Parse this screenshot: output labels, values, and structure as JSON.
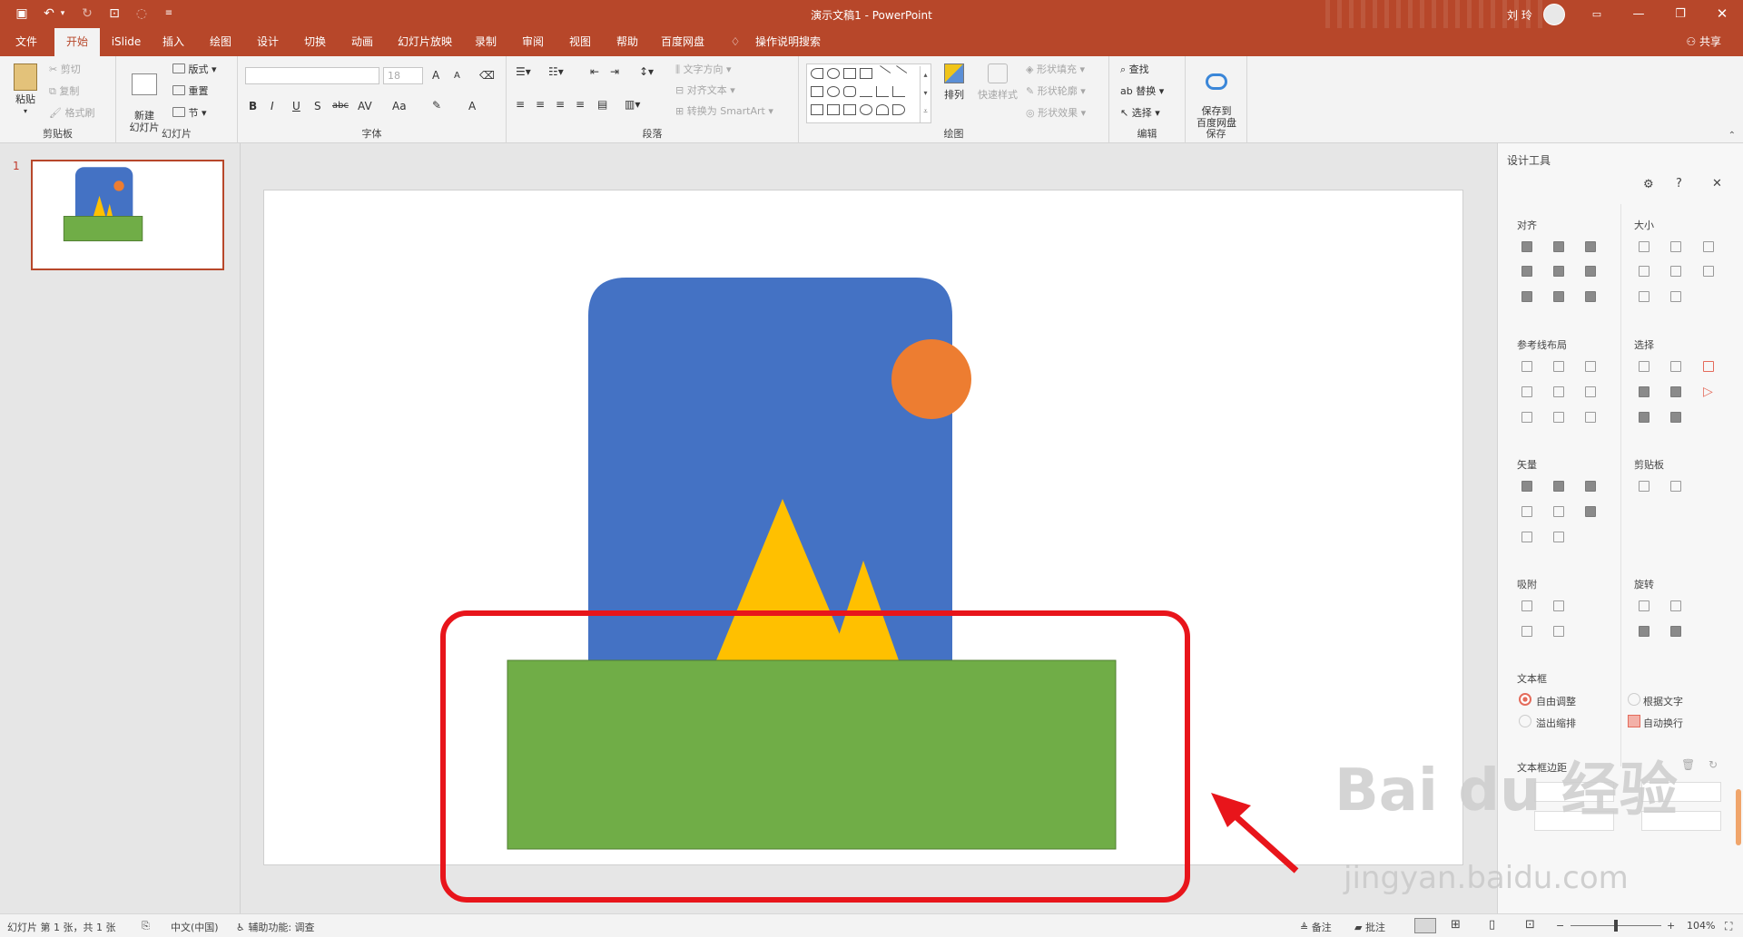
{
  "titlebar": {
    "title": "演示文稿1  -  PowerPoint",
    "user": "刘 玲"
  },
  "tabs": [
    "文件",
    "开始",
    "iSlide",
    "插入",
    "绘图",
    "设计",
    "切换",
    "动画",
    "幻灯片放映",
    "录制",
    "审阅",
    "视图",
    "帮助",
    "百度网盘",
    "操作说明搜索"
  ],
  "share": "共享",
  "ribbon": {
    "clipboard": {
      "label": "剪贴板",
      "paste": "粘贴",
      "cut": "剪切",
      "copy": "复制",
      "painter": "格式刷"
    },
    "slides": {
      "label": "幻灯片",
      "new_slide": "新建\n幻灯片",
      "layout": "版式",
      "reset": "重置",
      "section": "节"
    },
    "font": {
      "label": "字体",
      "size": "18",
      "bold": "B",
      "italic": "I",
      "underline": "U",
      "shadow": "S",
      "strike": "abc",
      "spacing": "AV",
      "case": "Aa",
      "grow": "A",
      "shrink": "A",
      "color": "A"
    },
    "paragraph": {
      "label": "段落",
      "text_dir": "文字方向",
      "align_text": "对齐文本",
      "smartart": "转换为 SmartArt"
    },
    "drawing": {
      "label": "绘图",
      "arrange": "排列",
      "quick_style": "快速样式",
      "fill": "形状填充",
      "outline": "形状轮廓",
      "effect": "形状效果"
    },
    "editing": {
      "label": "编辑",
      "find": "查找",
      "replace": "替换",
      "select": "选择"
    },
    "save": {
      "label": "保存",
      "button": "保存到\n百度网盘"
    }
  },
  "thumbs": {
    "slide_number": "1"
  },
  "pane": {
    "title": "设计工具",
    "sections": {
      "align": "对齐",
      "size": "大小",
      "guides": "参考线布局",
      "select": "选择",
      "vector": "矢量",
      "clipboard": "剪贴板",
      "snap": "吸附",
      "rotate": "旋转",
      "textbox": "文本框",
      "margin": "文本框边距"
    },
    "textbox_options": {
      "auto_adjust": "自由调整",
      "by_text": "根据文字",
      "overflow": "溢出缩排",
      "auto_wrap": "自动换行"
    }
  },
  "status": {
    "slide_info": "幻灯片 第 1 张，共 1 张",
    "language": "中文(中国)",
    "accessibility": "辅助功能: 调查",
    "notes": "备注",
    "comments": "批注",
    "zoom": "104%"
  },
  "colors": {
    "accent": "#b7472a",
    "sky": "#4472c4",
    "sun": "#ed7d31",
    "mountain": "#ffc000",
    "grass": "#70ad47",
    "highlight": "#e8151b"
  },
  "watermark": {
    "logo": "Bai du 经验",
    "url": "jingyan.baidu.com"
  }
}
